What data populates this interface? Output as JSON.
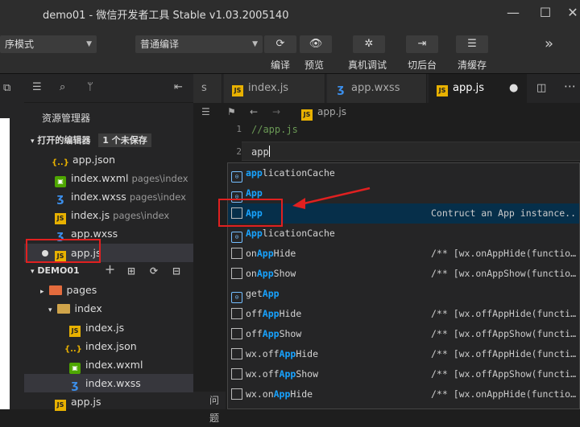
{
  "window": {
    "title": "demo01 - 微信开发者工具 Stable v1.03.2005140",
    "minimize": "—",
    "maximize": "☐",
    "close": "✕"
  },
  "toolbar": {
    "mode_select": "序模式",
    "compile_select": "普通编译",
    "buttons": [
      {
        "label": "编译",
        "icon": "⟳"
      },
      {
        "label": "预览",
        "icon": "👁"
      },
      {
        "label": "真机调试",
        "icon": "✲"
      },
      {
        "label": "切后台",
        "icon": "⇥"
      },
      {
        "label": "清缓存",
        "icon": "☰"
      }
    ],
    "more": "»"
  },
  "sidebar": {
    "explorer_title": "资源管理器",
    "open_editors_label": "打开的编辑器",
    "unsaved_badge": "1 个未保存",
    "open_files": [
      {
        "name": "app.json",
        "path": "",
        "type": "json"
      },
      {
        "name": "index.wxml",
        "path": "pages\\index",
        "type": "wxml"
      },
      {
        "name": "index.wxss",
        "path": "pages\\index",
        "type": "wxss"
      },
      {
        "name": "index.js",
        "path": "pages\\index",
        "type": "js"
      },
      {
        "name": "app.wxss",
        "path": "",
        "type": "wxss"
      },
      {
        "name": "app.js",
        "path": "",
        "type": "js"
      }
    ],
    "project_label": "DEMO01",
    "tree": [
      {
        "name": "pages",
        "type": "folderp",
        "indent": 1
      },
      {
        "name": "index",
        "type": "folder",
        "indent": 2
      },
      {
        "name": "index.js",
        "type": "js",
        "indent": 3
      },
      {
        "name": "index.json",
        "type": "json",
        "indent": 3
      },
      {
        "name": "index.wxml",
        "type": "wxml",
        "indent": 3
      },
      {
        "name": "index.wxss",
        "type": "wxss",
        "indent": 3
      },
      {
        "name": "app.js",
        "type": "js",
        "indent": 1
      }
    ]
  },
  "editor": {
    "tabs": [
      {
        "label": "s",
        "icon": ""
      },
      {
        "label": "index.js",
        "icon": "js"
      },
      {
        "label": "app.wxss",
        "icon": "wxss"
      },
      {
        "label": "app.js",
        "icon": "js",
        "active": true
      }
    ],
    "breadcrumb": "app.js",
    "lines": [
      {
        "num": "1",
        "text": "//app.js"
      },
      {
        "num": "2",
        "text": "app"
      }
    ],
    "suggestions": [
      {
        "pre": "",
        "hl": "app",
        "post": "licationCache",
        "kind": "mod",
        "detail": ""
      },
      {
        "pre": "",
        "hl": "App",
        "post": "",
        "kind": "mod",
        "detail": ""
      },
      {
        "pre": "",
        "hl": "App",
        "post": "",
        "kind": "fn",
        "detail": "Contruct an App instance...",
        "selected": true
      },
      {
        "pre": "",
        "hl": "App",
        "post": "licationCache",
        "kind": "mod",
        "detail": ""
      },
      {
        "pre": "on",
        "hl": "App",
        "post": "Hide",
        "kind": "fn",
        "detail": "/** [wx.onAppHide(functio…"
      },
      {
        "pre": "on",
        "hl": "App",
        "post": "Show",
        "kind": "fn",
        "detail": "/** [wx.onAppShow(functio…"
      },
      {
        "pre": "get",
        "hl": "App",
        "post": "",
        "kind": "mod",
        "detail": ""
      },
      {
        "pre": "off",
        "hl": "App",
        "post": "Hide",
        "kind": "fn",
        "detail": "/** [wx.offAppHide(functi…"
      },
      {
        "pre": "off",
        "hl": "App",
        "post": "Show",
        "kind": "fn",
        "detail": "/** [wx.offAppShow(functi…"
      },
      {
        "pre": "wx.off",
        "hl": "App",
        "post": "Hide",
        "kind": "fn",
        "detail": "/** [wx.offAppHide(functi…"
      },
      {
        "pre": "wx.off",
        "hl": "App",
        "post": "Show",
        "kind": "fn",
        "detail": "/** [wx.offAppShow(functi…"
      },
      {
        "pre": "wx.on",
        "hl": "App",
        "post": "Hide",
        "kind": "fn",
        "detail": "/** [wx.onAppHide(functio…"
      }
    ]
  },
  "bottom_panel": {
    "tab": "问题"
  },
  "colors": {
    "highlight": "#18a3ff",
    "annotation_red": "#e02020"
  }
}
